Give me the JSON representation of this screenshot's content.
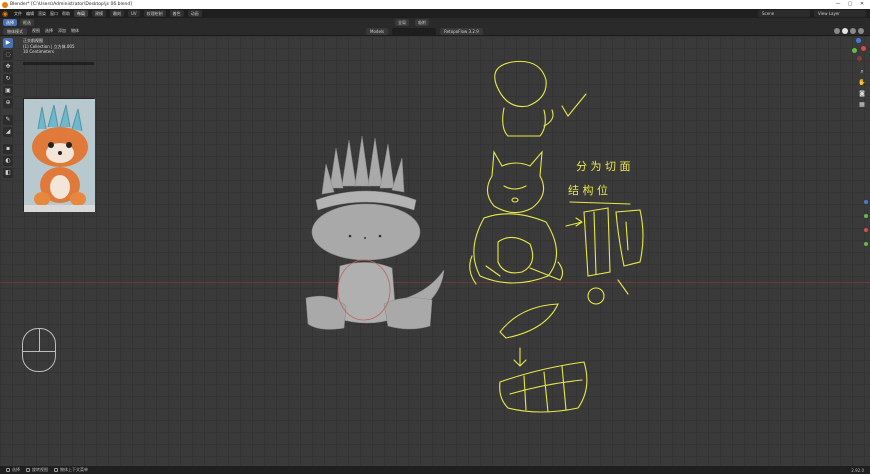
{
  "window": {
    "title": "Blender* [C:\\Users\\Administrator\\Desktop\\js 06.blend]",
    "buttons": [
      "—",
      "▢",
      "✕"
    ]
  },
  "menubar": {
    "items": [
      "文件",
      "编辑",
      "渲染",
      "窗口",
      "帮助"
    ],
    "workspaces": [
      "布局",
      "建模",
      "雕刻",
      "UV",
      "纹理绘制",
      "着色",
      "动画"
    ],
    "scene_value": "Scene",
    "view_layer_value": "View Layer"
  },
  "header": {
    "tools": [
      "选择",
      "框选"
    ],
    "transform_orientation": "全局",
    "snap": "吸附"
  },
  "header2": {
    "mode": "物体模式",
    "menus": [
      "视图",
      "选择",
      "添加",
      "物体"
    ],
    "addon_dropdown": "Models",
    "version_dropdown": "RetopoFlow 3.2.9"
  },
  "overlay": {
    "view_name": "正交前视图",
    "collection": "(1) Collection | 立方体.005",
    "unit": "10 Centimeters"
  },
  "toolbar": {
    "icons": [
      "cursor-icon",
      "select-box-icon",
      "move-icon",
      "rotate-icon",
      "scale-icon",
      "transform-icon",
      "annotate-icon",
      "measure-icon",
      "add-cube-icon",
      "shrink-icon",
      "edit-icon"
    ]
  },
  "statusbar": {
    "items": [
      "选择",
      "旋转视图",
      "物体上下文菜单"
    ],
    "version": "2.92.0"
  },
  "sketch": {
    "notes_line1": "分 为 切 面",
    "notes_line2": "结 构 位"
  },
  "colors": {
    "accent": "#4772b3",
    "sketch": "#e8e84a",
    "model": "#a8a8a8",
    "blender_orange": "#e87d0d",
    "gizmo_x": "#d94a4a",
    "gizmo_y": "#6bb84a",
    "gizmo_z": "#4a7ad9"
  }
}
